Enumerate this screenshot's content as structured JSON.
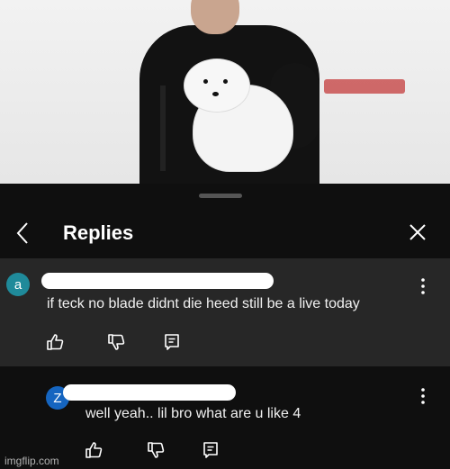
{
  "header": {
    "title": "Replies"
  },
  "comment1": {
    "avatar_letter": "a",
    "avatar_color": "#1f8a9a",
    "text": "if teck no blade didnt die heed still be a live today"
  },
  "comment2": {
    "avatar_letter": "Z",
    "avatar_color": "#1565c0",
    "text": "well yeah.. lil bro what are u like 4"
  },
  "icons": [
    "back-arrow-icon",
    "close-icon",
    "more-vert-icon",
    "thumbs-up-icon",
    "thumbs-down-icon",
    "reply-icon"
  ],
  "watermark": "imgflip.com"
}
